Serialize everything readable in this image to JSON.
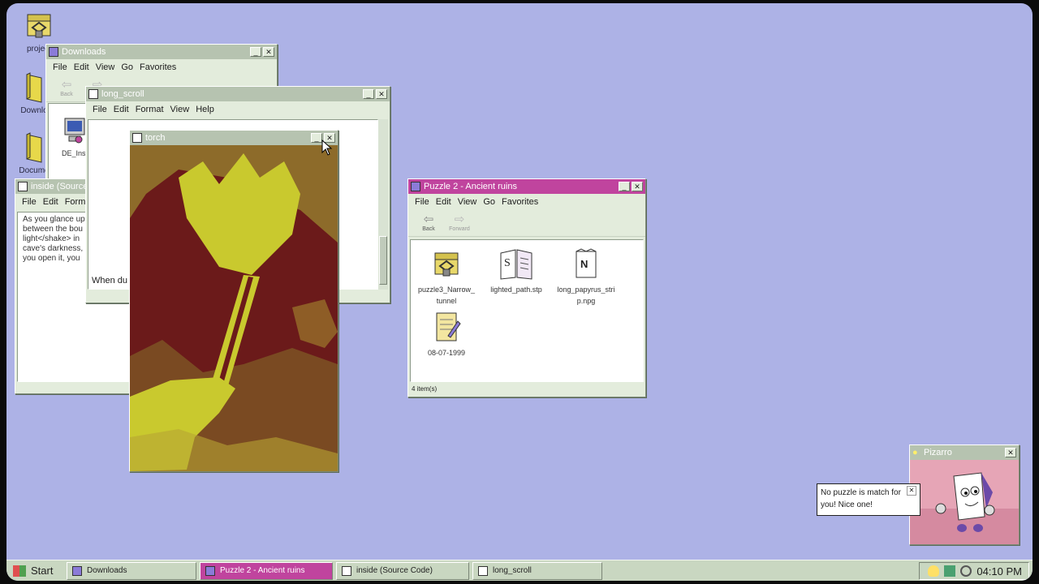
{
  "desktop_icons": [
    {
      "label": "project",
      "icon": "locked-chest-icon"
    },
    {
      "label": "Downlo",
      "icon": "folder-icon"
    },
    {
      "label": "Docume",
      "icon": "folder-icon"
    }
  ],
  "downloads_window": {
    "title": "Downloads",
    "menu": [
      "File",
      "Edit",
      "View",
      "Go",
      "Favorites"
    ],
    "nav": {
      "back": "Back",
      "forward": "Fo"
    },
    "file_label": "DE_Inst"
  },
  "long_scroll_window": {
    "title": "long_scroll",
    "menu": [
      "File",
      "Edit",
      "Format",
      "View",
      "Help"
    ],
    "text": "When du"
  },
  "inside_window": {
    "title": "inside (Source",
    "menu": [
      "File",
      "Edit",
      "Form"
    ],
    "text_lines": [
      "As you glance up",
      "between the bou",
      "light</shake> in",
      "cave's darkness,",
      "you open it, you"
    ]
  },
  "torch_window": {
    "title": "torch"
  },
  "puzzle_window": {
    "title": "Puzzle 2 - Ancient ruins",
    "menu": [
      "File",
      "Edit",
      "View",
      "Go",
      "Favorites"
    ],
    "nav": {
      "back": "Back",
      "forward": "Forward"
    },
    "files": [
      {
        "label": "puzzle3_Narrow_\ntunnel",
        "icon": "locked-chest-icon"
      },
      {
        "label": "lighted_path.stp",
        "icon": "book-icon"
      },
      {
        "label": "long_papyrus_stri\np.npg",
        "icon": "notepad-icon"
      },
      {
        "label": "08-07-1999",
        "icon": "journal-icon"
      }
    ],
    "status": "4 item(s)"
  },
  "pizarro": {
    "title": "Pizarro",
    "message": "No puzzle is match for you! Nice one!"
  },
  "taskbar": {
    "start": "Start",
    "items": [
      {
        "label": "Downloads",
        "active": false
      },
      {
        "label": "Puzzle 2 - Ancient ruins",
        "active": true
      },
      {
        "label": "inside (Source Code)",
        "active": false
      },
      {
        "label": "long_scroll",
        "active": false
      }
    ],
    "clock": "04:10 PM"
  },
  "colors": {
    "desktop": "#adb2e6",
    "window": "#e3ecdc",
    "active_title": "#c0449e",
    "inactive_title": "#b6c3b0",
    "torch_dark": "#6b1a1a",
    "torch_light": "#c9c92e"
  }
}
